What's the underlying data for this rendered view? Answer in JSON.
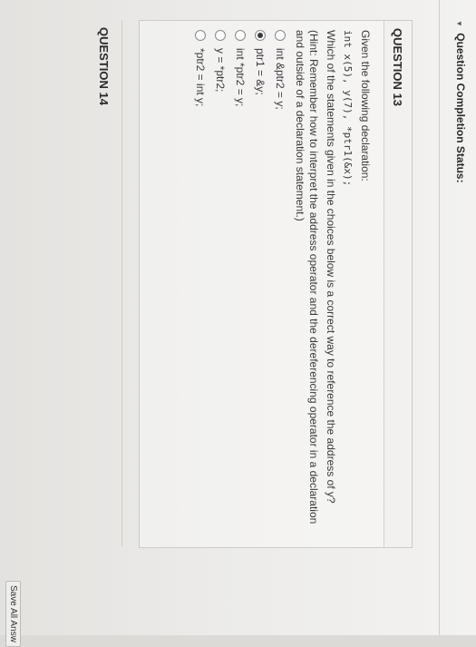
{
  "header": {
    "status_label": "Question Completion Status:"
  },
  "question13": {
    "title": "QUESTION 13",
    "intro": "Given the following declaration:",
    "code": "int x(5), y(7), *ptr1(&x);",
    "prompt": "Which of the statements given in the choices below is a correct way to reference the address of y?",
    "hint": "(Hint: Remember how to interpret the address operator and the dereferencing operator in a declaration and outside of a declaration statement.)",
    "choices": [
      {
        "label": "int &ptr2 = y;",
        "selected": false
      },
      {
        "label": "ptr1 = &y;",
        "selected": true
      },
      {
        "label": "int *ptr2 = y;",
        "selected": false
      },
      {
        "label": "y = *ptr2;",
        "selected": false
      },
      {
        "label": "*ptr2 = int y;",
        "selected": false
      }
    ]
  },
  "question14": {
    "title": "QUESTION 14"
  },
  "footer": {
    "save_label": "Save All Answ"
  }
}
